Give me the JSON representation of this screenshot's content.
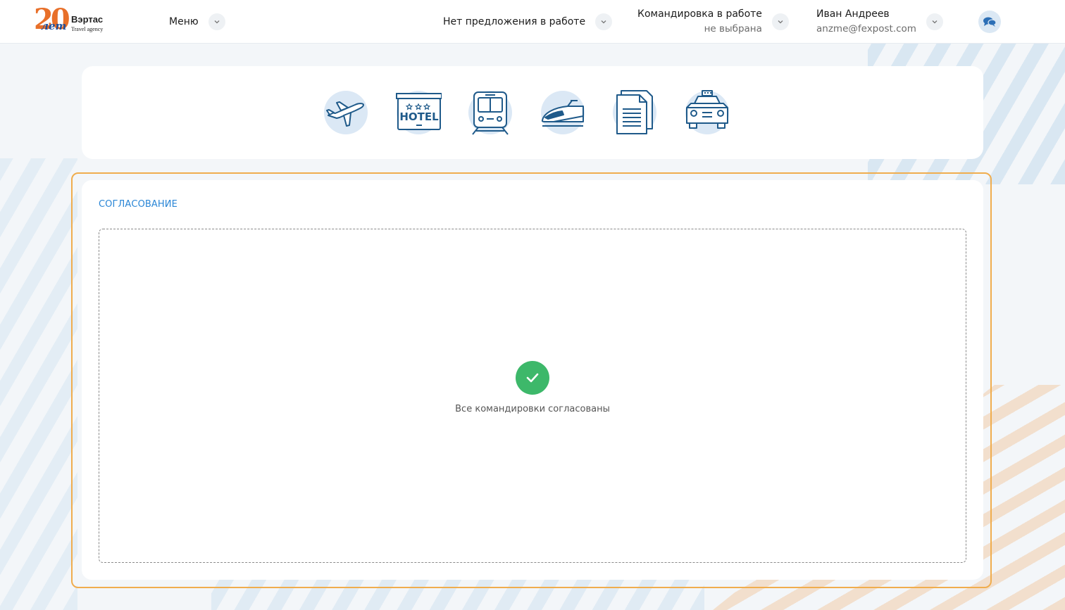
{
  "logo": {
    "number": "20",
    "years": "лет",
    "name": "Вэртас",
    "subtitle": "Travel agency"
  },
  "header": {
    "menu_label": "Меню",
    "offer_label": "Нет предложения в работе",
    "trip": {
      "title": "Командировка в работе",
      "value": "не выбрана"
    },
    "user": {
      "name": "Иван Андреев",
      "email": "anzme@fexpost.com"
    }
  },
  "services": [
    {
      "icon": "airplane-icon"
    },
    {
      "icon": "hotel-icon",
      "label": "HOTEL"
    },
    {
      "icon": "train-icon"
    },
    {
      "icon": "high-speed-train-icon"
    },
    {
      "icon": "document-icon"
    },
    {
      "icon": "taxi-icon"
    }
  ],
  "approval": {
    "title": "СОГЛАСОВАНИЕ",
    "empty_message": "Все командировки согласованы"
  },
  "colors": {
    "accent_blue": "#2a86d6",
    "icon_blue": "#1f5a8a",
    "highlight_orange": "#f0ad4e",
    "success_green": "#3db86a"
  }
}
